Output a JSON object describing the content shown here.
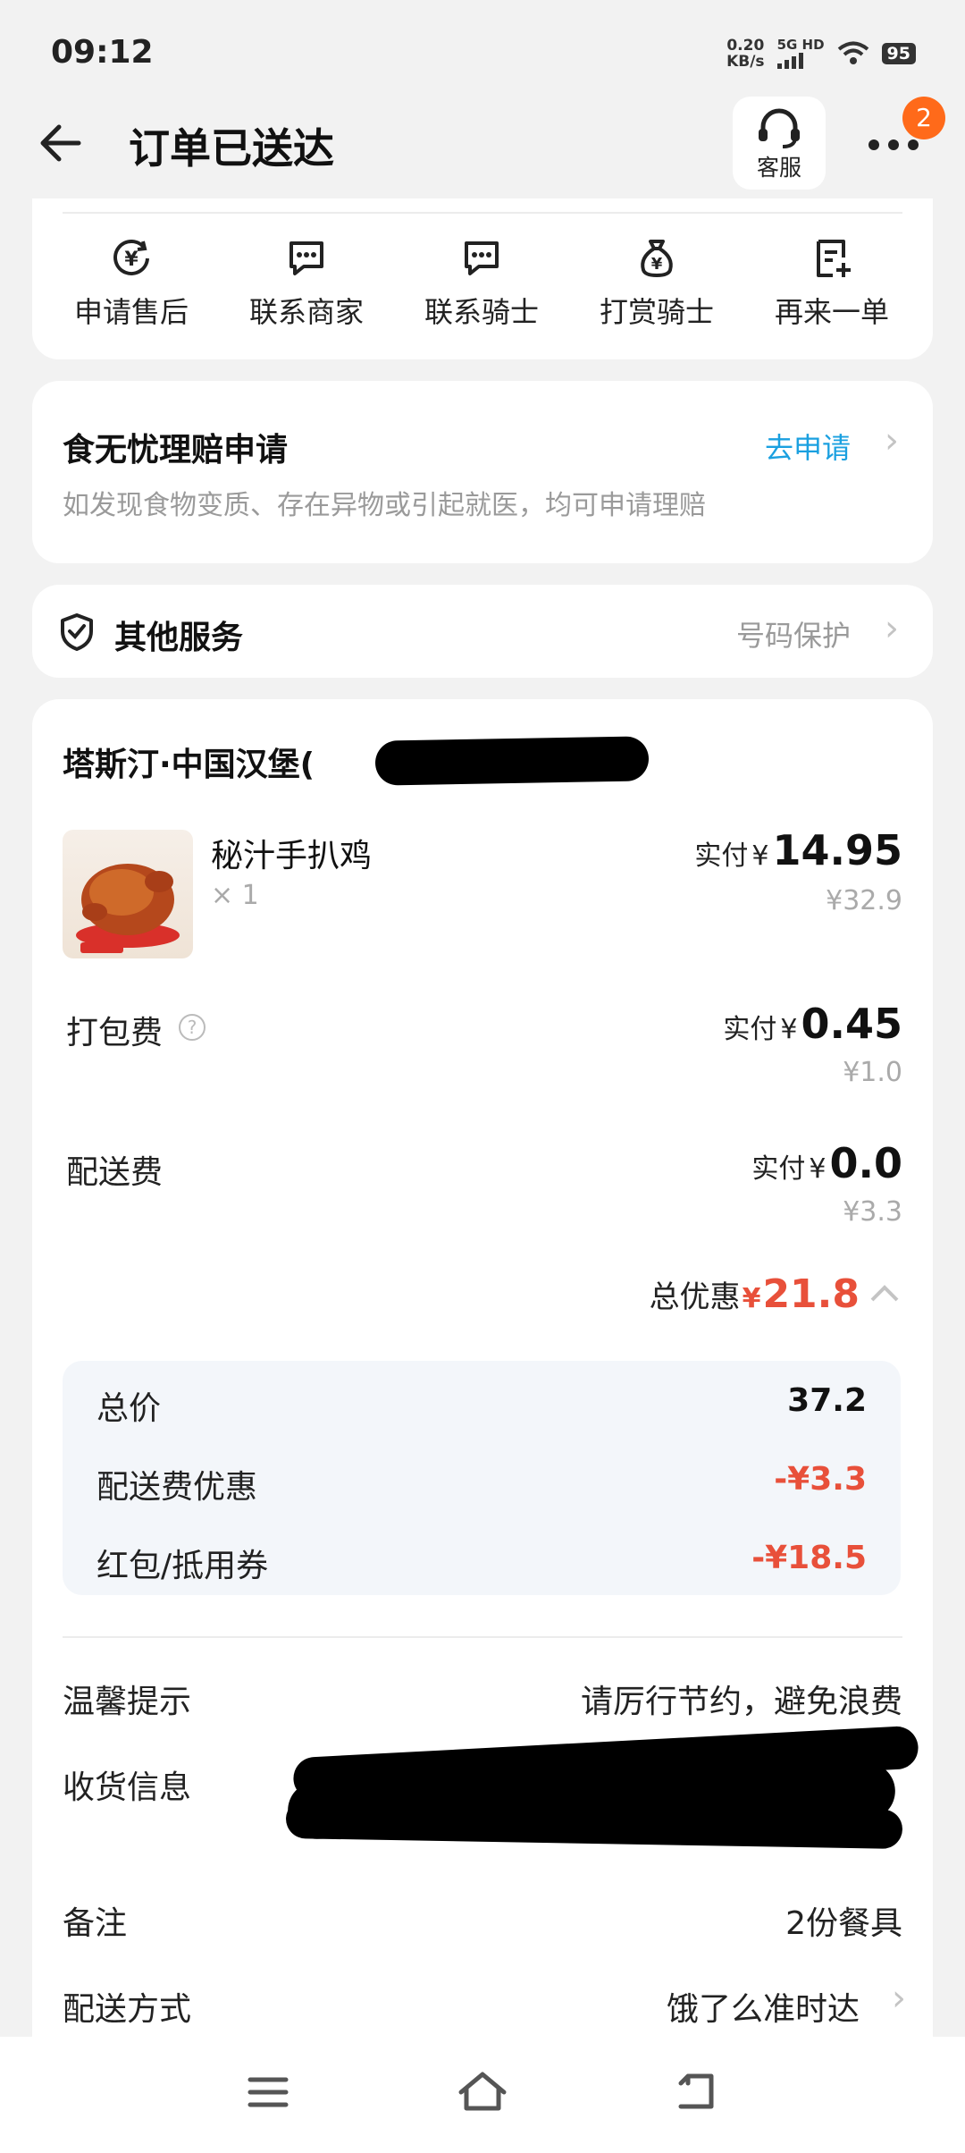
{
  "status": {
    "time": "09:12",
    "net_speed_value": "0.20",
    "net_speed_unit": "KB/s",
    "signal_label": "5G HD",
    "battery": "95"
  },
  "header": {
    "title": "订单已送达",
    "customer_service": "客服",
    "notification_count": "2"
  },
  "actions": [
    {
      "label": "申请售后",
      "icon": "after-sale-icon"
    },
    {
      "label": "联系商家",
      "icon": "chat-icon"
    },
    {
      "label": "联系骑士",
      "icon": "chat-icon"
    },
    {
      "label": "打赏骑士",
      "icon": "money-bag-icon"
    },
    {
      "label": "再来一单",
      "icon": "reorder-icon"
    }
  ],
  "claim": {
    "title": "食无忧理赔申请",
    "link": "去申请",
    "desc": "如发现食物变质、存在异物或引起就医，均可申请理赔"
  },
  "services": {
    "title": "其他服务",
    "link": "号码保护"
  },
  "store": {
    "name": "塔斯汀·中国汉堡(",
    "item_name": "秘汁手扒鸡",
    "item_qty": "× 1",
    "item_paid_label": "实付",
    "item_currency": "¥",
    "item_paid": "14.95",
    "item_orig": "¥32.9"
  },
  "fees": {
    "packing_label": "打包费",
    "packing_paid_label": "实付",
    "packing_currency": "¥",
    "packing_paid": "0.45",
    "packing_orig": "¥1.0",
    "delivery_label": "配送费",
    "delivery_paid_label": "实付",
    "delivery_currency": "¥",
    "delivery_paid": "0.0",
    "delivery_orig": "¥3.3"
  },
  "discount": {
    "label": "总优惠",
    "currency": "¥",
    "amount": "21.8"
  },
  "breakdown": {
    "total_label": "总价",
    "total_value": "37.2",
    "delivery_discount_label": "配送费优惠",
    "delivery_discount_value": "-¥3.3",
    "coupon_label": "红包/抵用券",
    "coupon_value": "-¥18.5"
  },
  "info": {
    "tip_label": "温馨提示",
    "tip_value": "请厉行节约，避免浪费",
    "address_label": "收货信息",
    "note_label": "备注",
    "note_value": "2份餐具",
    "delivery_method_label": "配送方式",
    "delivery_method_value": "饿了么准时达"
  },
  "colors": {
    "accent_blue": "#1aa0e0",
    "discount_red": "#e8503a",
    "badge_orange": "#ff6a1a"
  }
}
